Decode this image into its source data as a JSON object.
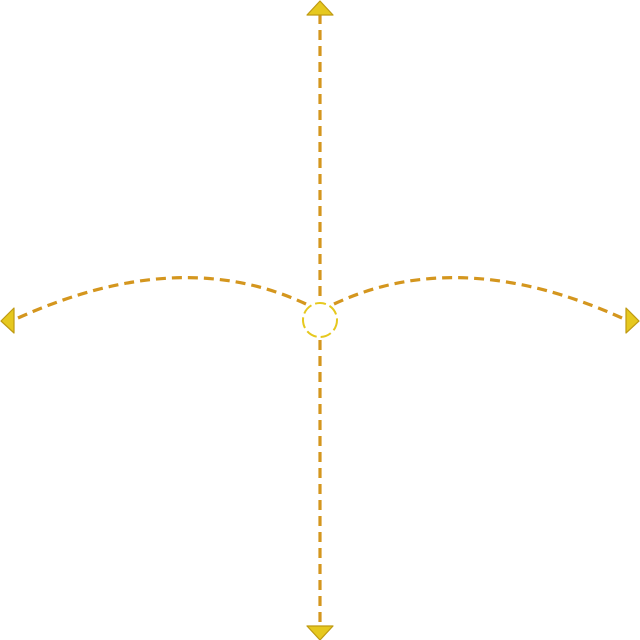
{
  "gizmo": {
    "stroke_color": "#D4961E",
    "arrow_fill": "#E6C81E",
    "arrow_stroke": "#BF9A12",
    "center_fill": "#FFFFFF",
    "center_stroke": "#E6C81E",
    "handles": [
      {
        "name": "move-up-arrow-handle",
        "icon": "triangle-up-icon"
      },
      {
        "name": "move-down-arrow-handle",
        "icon": "triangle-down-icon"
      },
      {
        "name": "move-left-arrow-handle",
        "icon": "triangle-left-icon"
      },
      {
        "name": "move-right-arrow-handle",
        "icon": "triangle-right-icon"
      }
    ],
    "center_handle": {
      "name": "center-drag-handle",
      "icon": "dashed-circle-icon"
    }
  }
}
